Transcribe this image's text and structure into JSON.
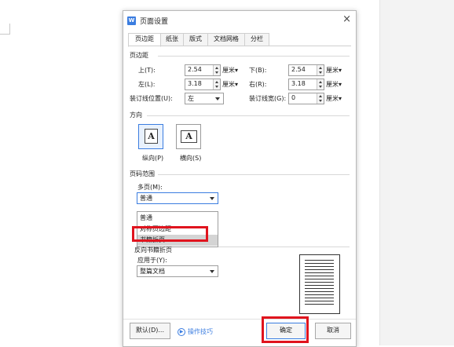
{
  "dialog": {
    "app_icon": "W",
    "title": "页面设置",
    "close_icon": "×"
  },
  "tabs": [
    "页边距",
    "纸张",
    "版式",
    "文档网格",
    "分栏"
  ],
  "margins": {
    "section_title": "页边距",
    "top_label": "上(T):",
    "top_value": "2.54",
    "bottom_label": "下(B):",
    "bottom_value": "2.54",
    "left_label": "左(L):",
    "left_value": "3.18",
    "right_label": "右(R):",
    "right_value": "3.18",
    "gutter_pos_label": "装订线位置(U):",
    "gutter_pos_value": "左",
    "gutter_width_label": "装订线宽(G):",
    "gutter_width_value": "0",
    "unit": "厘米"
  },
  "orientation": {
    "section_title": "方向",
    "portrait_label": "纵向(P)",
    "landscape_label": "横向(S)",
    "glyph": "A"
  },
  "page_range": {
    "section_title": "页码范围",
    "multi_label": "多页(M):",
    "multi_value": "普通",
    "options": [
      "普通",
      "对称页边距",
      "书籍折页",
      "反向书籍折页"
    ],
    "hovered_option": "书籍折页"
  },
  "apply": {
    "label": "应用于(Y):",
    "value": "整篇文档"
  },
  "footer": {
    "default_button": "默认(D)...",
    "tips_link": "操作技巧",
    "ok_button": "确定",
    "cancel_button": "取消"
  },
  "colors": {
    "accent": "#3b7de0",
    "highlight_box": "#e0141e",
    "hover_bg": "#d4d4d4"
  }
}
